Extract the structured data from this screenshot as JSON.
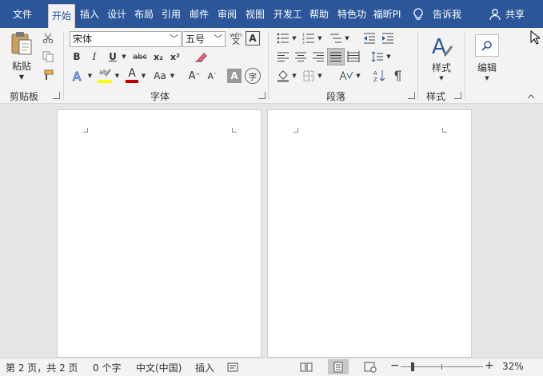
{
  "tabs": {
    "file": "文件",
    "home": "开始",
    "insert": "插入",
    "design": "设计",
    "layout": "布局",
    "references": "引用",
    "mailings": "邮件",
    "review": "审阅",
    "view": "视图",
    "developer": "开发工",
    "help": "帮助",
    "special": "特色功",
    "foxit": "福昕PI",
    "tell_me": "告诉我",
    "share": "共享"
  },
  "clipboard": {
    "paste_label": "粘贴",
    "group_label": "剪贴板"
  },
  "font": {
    "font_name": "宋体",
    "font_size": "五号",
    "group_label": "字体",
    "bold": "B",
    "italic": "I",
    "underline": "U",
    "strike": "abc",
    "subscript": "x₂",
    "superscript": "x²",
    "grow": "A",
    "shrink": "A",
    "case": "Aa",
    "phonetic_top": "wén",
    "phonetic_bottom": "文",
    "border_char": "A",
    "shading_char": "A",
    "enclose_char": "字"
  },
  "paragraph": {
    "group_label": "段落"
  },
  "styles": {
    "label": "样式",
    "group_label": "样式"
  },
  "editing": {
    "label": "编辑"
  },
  "status": {
    "page": "第 2 页，共 2 页",
    "words": "0 个字",
    "language": "中文(中国)",
    "mode": "插入",
    "zoom": "32%"
  },
  "colors": {
    "tab_blue": "#2b579a",
    "highlight_yellow": "#ffff00",
    "font_red": "#c00000"
  }
}
